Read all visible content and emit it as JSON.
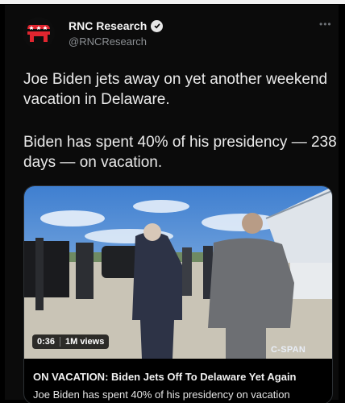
{
  "post": {
    "author": "RNC Research",
    "handle": "@RNCResearch",
    "paragraphs": [
      "Joe Biden jets away on yet another weekend vacation in Delaware.",
      "Biden has spent 40% of his presidency — 238 days — on vacation."
    ]
  },
  "icons": {
    "avatar": "gop-elephant-icon",
    "verified": "verified-badge-icon",
    "more": "more-options-icon"
  },
  "colors": {
    "background": "#000000",
    "elephant": "#e0252f",
    "text": "#eaeaea",
    "muted": "#8b8f93"
  },
  "card": {
    "duration": "0:36",
    "views": "1M views",
    "network": "C-SPAN",
    "title": "ON VACATION: Biden Jets Off To Delaware Yet Again",
    "description": "Joe Biden has spent 40% of his presidency on vacation"
  }
}
